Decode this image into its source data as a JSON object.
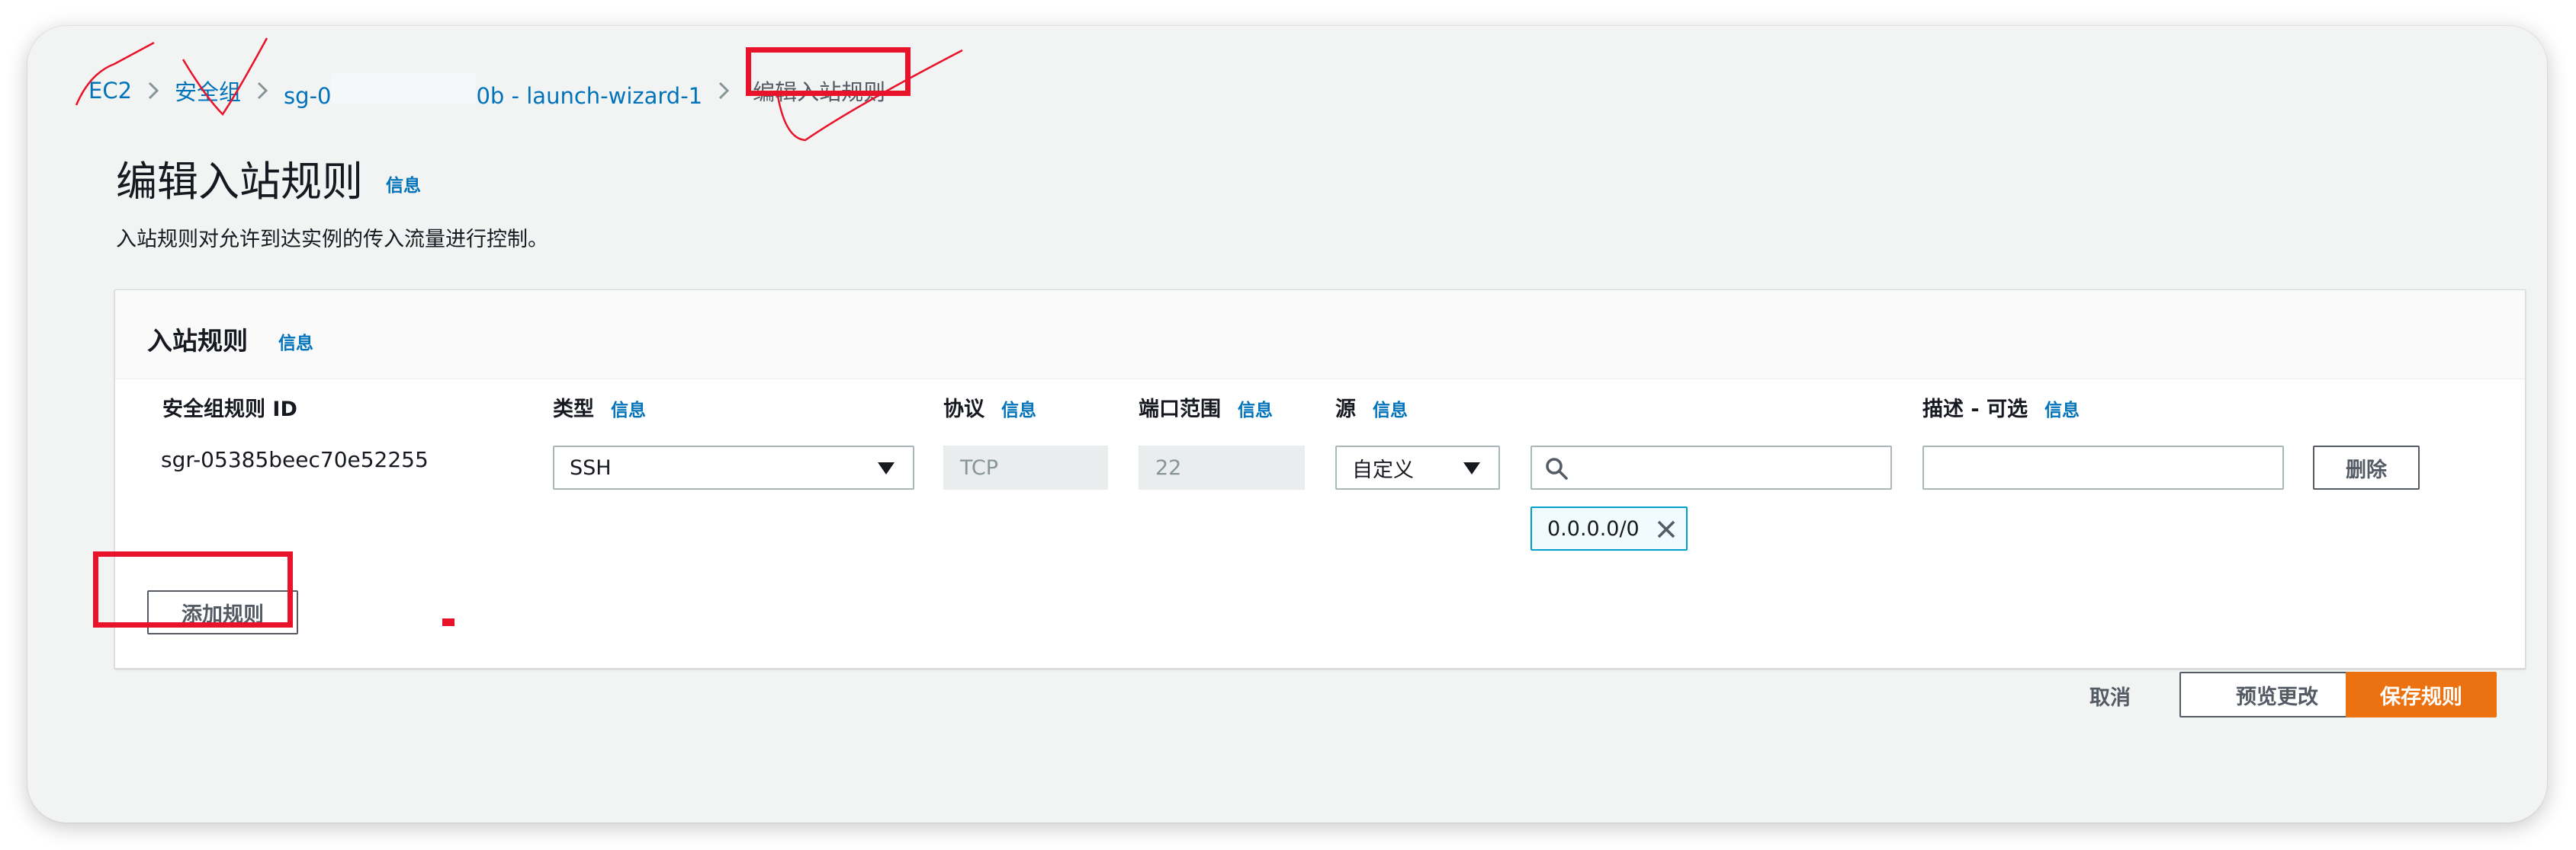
{
  "breadcrumb": {
    "items": [
      "EC2",
      "安全组",
      "sg-0",
      "0b - launch-wizard-1"
    ],
    "current": "编辑入站规则"
  },
  "page": {
    "title": "编辑入站规则",
    "info": "信息",
    "description": "入站规则对允许到达实例的传入流量进行控制。"
  },
  "panel": {
    "title": "入站规则",
    "info": "信息",
    "columns": [
      {
        "label": "安全组规则 ID",
        "info": ""
      },
      {
        "label": "类型",
        "info": "信息"
      },
      {
        "label": "协议",
        "info": "信息"
      },
      {
        "label": "端口范围",
        "info": "信息"
      },
      {
        "label": "源",
        "info": "信息"
      },
      {
        "label": "描述 - 可选",
        "info": "信息"
      }
    ],
    "rule": {
      "id": "sgr-05385beec70e52255",
      "type": "SSH",
      "protocol": "TCP",
      "port_range": "22",
      "source_type": "自定义",
      "source_search_value": "",
      "source_token": "0.0.0.0/0",
      "description": "",
      "delete_label": "删除"
    },
    "add_rule_label": "添加规则"
  },
  "footer": {
    "cancel_label": "取消",
    "preview_label": "预览更改",
    "save_label": "保存规则"
  },
  "colors": {
    "link": "#0073bb",
    "primary": "#ec7211",
    "annotation": "#e8132b",
    "token_border": "#00a1c9"
  },
  "icons": [
    "chevron-right-icon",
    "caret-down-icon",
    "search-icon",
    "close-icon"
  ]
}
